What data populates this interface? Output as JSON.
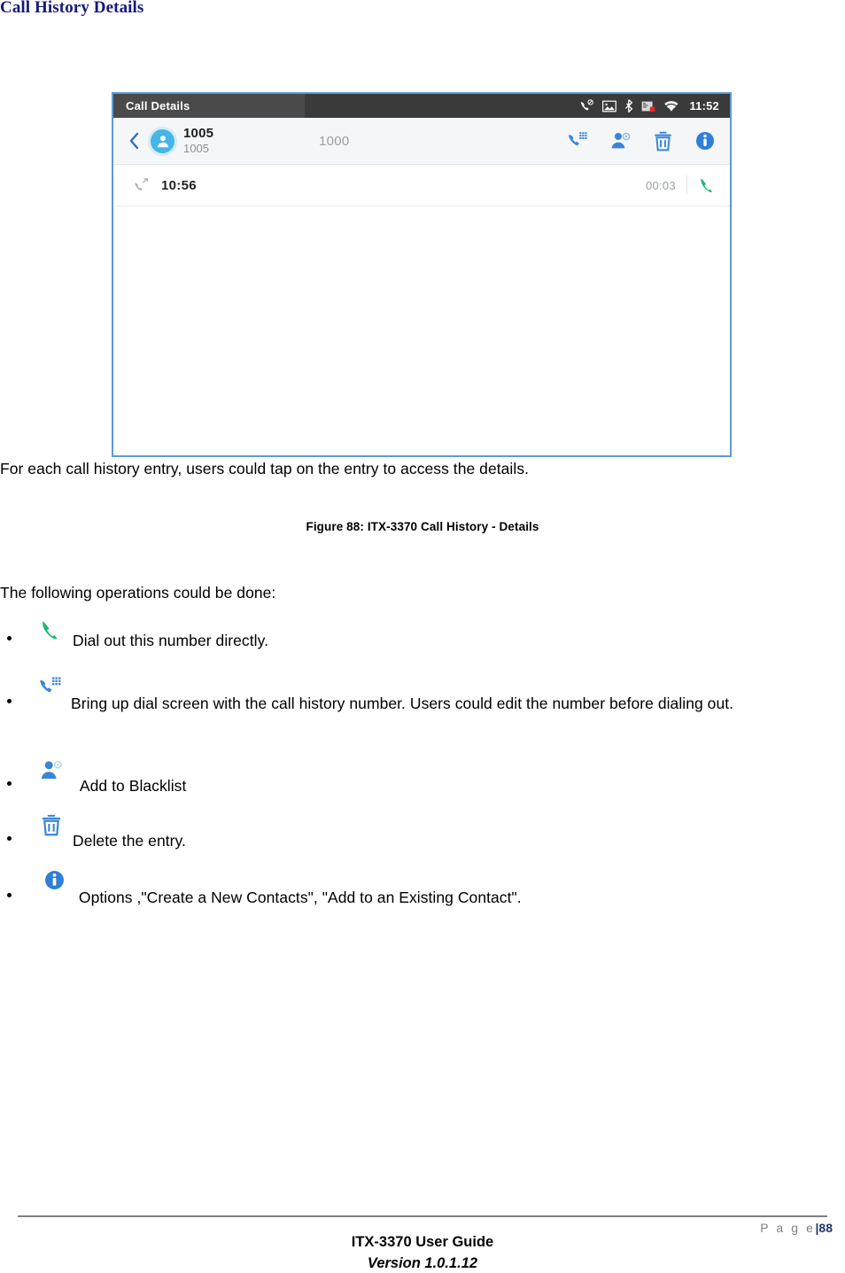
{
  "document": {
    "heading": "Call History Details",
    "intro_paragraph": "For each call history entry, users could tap on the entry to access the details.",
    "figure_caption": "Figure 88: ITX-3370 Call History - Details",
    "operations_lead": "The following operations could be done:"
  },
  "phone_screenshot": {
    "status_bar": {
      "title": "Call Details",
      "time": "11:52",
      "icons": [
        {
          "name": "missed-call-icon",
          "label": "missed call"
        },
        {
          "name": "screenshot-icon",
          "label": "screenshot"
        },
        {
          "name": "bluetooth-icon",
          "label": "bluetooth"
        },
        {
          "name": "sd-card-alert-icon",
          "label": "storage alert"
        },
        {
          "name": "wifi-icon",
          "label": "wifi"
        }
      ]
    },
    "contact_header": {
      "back_icon": "back-chevron-icon",
      "avatar_icon": "contact-avatar-icon",
      "name": "1005",
      "extension": "1005",
      "peer_number": "1000",
      "actions": [
        {
          "name": "dial-keypad-icon",
          "label": "Bring up dial screen"
        },
        {
          "name": "add-blacklist-icon",
          "label": "Add to Blacklist"
        },
        {
          "name": "delete-icon",
          "label": "Delete the entry"
        },
        {
          "name": "info-icon",
          "label": "Options"
        }
      ]
    },
    "call_entry": {
      "direction_icon": "outgoing-call-icon",
      "time": "10:56",
      "duration": "00:03",
      "call_icon": "dial-out-icon"
    },
    "colors": {
      "status_bar_bg": "#3a3a3a",
      "accent_blue": "#3a86d6",
      "avatar_blue": "#45b6e8",
      "call_green": "#21b573",
      "border_blue": "#5b9bd5"
    }
  },
  "operations": [
    {
      "icon": "dial-out-green-icon",
      "text": "Dial out this number directly."
    },
    {
      "icon": "dial-keypad-blue-icon",
      "text": "Bring up dial screen with the call history number. Users could edit the number before dialing out."
    },
    {
      "icon": "add-blacklist-blue-icon",
      "text": " Add to Blacklist"
    },
    {
      "icon": "delete-trash-blue-icon",
      "text": "Delete the entry."
    },
    {
      "icon": "info-blue-icon",
      "text": " Options ,\"Create a New Contacts\", \"Add to an Existing Contact\"."
    }
  ],
  "footer": {
    "page_word": "P a g e",
    "page_separator": "|",
    "page_number": "88",
    "guide_title": "ITX-3370 User Guide",
    "version": "Version 1.0.1.12"
  }
}
